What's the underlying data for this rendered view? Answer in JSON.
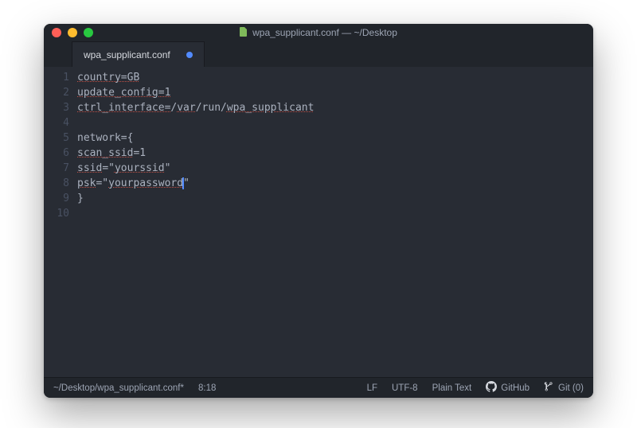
{
  "titlebar": {
    "title": "wpa_supplicant.conf — ~/Desktop"
  },
  "tab": {
    "filename": "wpa_supplicant.conf"
  },
  "code": {
    "lines": [
      {
        "chunks": [
          {
            "t": "country=GB",
            "cls": "dashed"
          }
        ]
      },
      {
        "chunks": [
          {
            "t": "update_config=1",
            "cls": "dashed"
          }
        ]
      },
      {
        "chunks": [
          {
            "t": "ctrl_interface=",
            "cls": "dashed"
          },
          {
            "t": "/",
            "cls": ""
          },
          {
            "t": "var",
            "cls": "dashed"
          },
          {
            "t": "/run/",
            "cls": ""
          },
          {
            "t": "wpa_supplicant",
            "cls": "dashed"
          }
        ]
      },
      {
        "chunks": [
          {
            "t": "",
            "cls": ""
          }
        ]
      },
      {
        "chunks": [
          {
            "t": "network={",
            "cls": ""
          }
        ]
      },
      {
        "chunks": [
          {
            "t": "scan_ssid",
            "cls": "dashed"
          },
          {
            "t": "=1",
            "cls": ""
          }
        ]
      },
      {
        "chunks": [
          {
            "t": "ssid",
            "cls": "dashed"
          },
          {
            "t": "=\"",
            "cls": ""
          },
          {
            "t": "yourssid",
            "cls": "dashed"
          },
          {
            "t": "\"",
            "cls": ""
          }
        ]
      },
      {
        "chunks": [
          {
            "t": "psk",
            "cls": "dashed"
          },
          {
            "t": "=\"",
            "cls": ""
          },
          {
            "t": "yourpassword",
            "cls": "dashed"
          },
          {
            "t": "",
            "cls": "",
            "cursor": true
          },
          {
            "t": "\"",
            "cls": ""
          }
        ]
      },
      {
        "chunks": [
          {
            "t": "}",
            "cls": ""
          }
        ]
      },
      {
        "chunks": [
          {
            "t": "",
            "cls": ""
          }
        ]
      }
    ],
    "line_count": 10
  },
  "statusbar": {
    "filepath": "~/Desktop/wpa_supplicant.conf*",
    "cursor_pos": "8:18",
    "line_ending": "LF",
    "encoding": "UTF-8",
    "grammar": "Plain Text",
    "github": "GitHub",
    "git": "Git (0)"
  }
}
